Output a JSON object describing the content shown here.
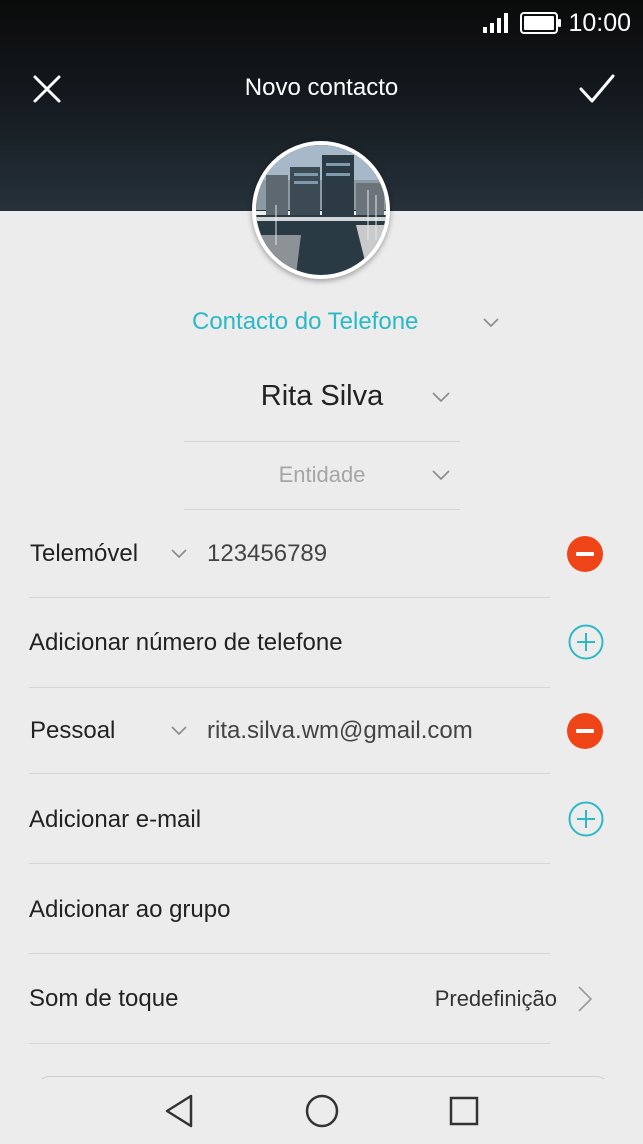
{
  "status_bar": {
    "time": "10:00"
  },
  "header": {
    "title": "Novo contacto",
    "close_icon": "close-icon",
    "confirm_icon": "check-icon"
  },
  "account": {
    "label": "Contacto do Telefone"
  },
  "name": {
    "value": "Rita Silva"
  },
  "company": {
    "placeholder": "Entidade"
  },
  "phone": {
    "type": "Telemóvel",
    "number": "123456789",
    "add_label": "Adicionar número de telefone"
  },
  "email": {
    "type": "Pessoal",
    "address": "rita.silva.wm@gmail.com",
    "add_label": "Adicionar e-mail"
  },
  "group": {
    "label": "Adicionar ao grupo"
  },
  "ringtone": {
    "label": "Som de toque",
    "value": "Predefinição"
  },
  "colors": {
    "accent": "#2bb9c8",
    "remove": "#ee4418"
  },
  "navigation": {
    "back_icon": "back-triangle-icon",
    "home_icon": "home-circle-icon",
    "recents_icon": "recents-square-icon"
  }
}
